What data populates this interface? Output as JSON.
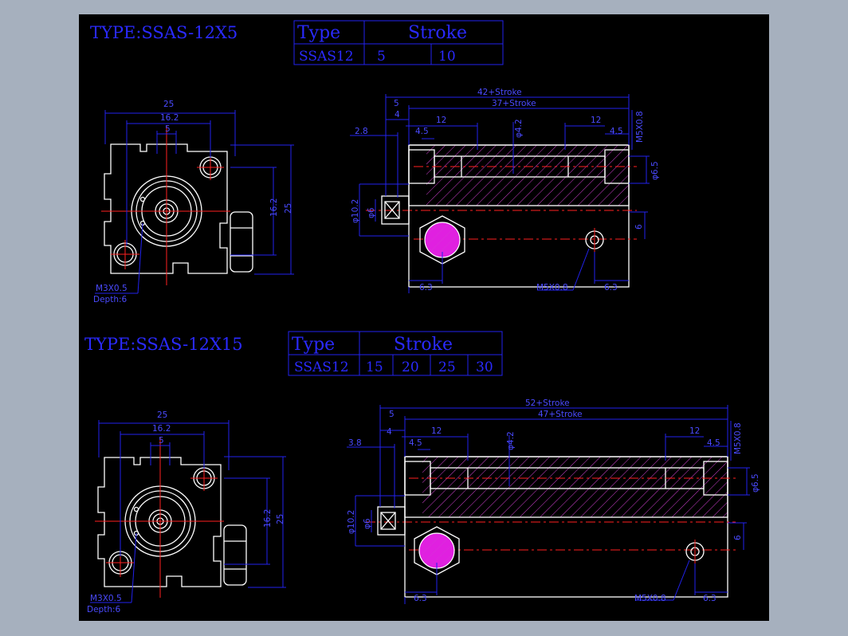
{
  "colors": {
    "background": "#a6b0be",
    "sheet": "#000000",
    "text": "#2a2aff",
    "outline": "#ffffff",
    "center": "#ff2020",
    "hatch": "#d040d0",
    "port": "#e020e0"
  },
  "drawing1": {
    "title": "TYPE:SSAS-12X5",
    "table": {
      "col1": "Type",
      "col2": "Stroke",
      "model": "SSAS12",
      "strokes": [
        "5",
        "10"
      ]
    },
    "front": {
      "d25": "25",
      "d16_2": "16.2",
      "d5": "5",
      "v16_2": "16.2",
      "v25": "25",
      "m3": "M3X0.5",
      "depth": "Depth:6"
    },
    "side": {
      "total": "42+Stroke",
      "d5": "5",
      "d37": "37+Stroke",
      "d4": "4",
      "d12a": "12",
      "d2_8": "2.8",
      "d4_5a": "4.5",
      "phi4_2": "φ4.2",
      "d12b": "12",
      "d4_5b": "4.5",
      "m5top": "M5X0.8",
      "phi6_5": "φ6.5",
      "phi10_2": "φ10.2",
      "phi6": "φ6",
      "v6": "6",
      "d6_3a": "6.3",
      "m5": "M5X0.8",
      "d6_3b": "6.3"
    }
  },
  "drawing2": {
    "title": "TYPE:SSAS-12X15",
    "table": {
      "col1": "Type",
      "col2": "Stroke",
      "model": "SSAS12",
      "strokes": [
        "15",
        "20",
        "25",
        "30"
      ]
    },
    "front": {
      "d25": "25",
      "d16_2": "16.2",
      "d5": "5",
      "v16_2": "16.2",
      "v25": "25",
      "m3": "M3X0.5",
      "depth": "Depth:6"
    },
    "side": {
      "total": "52+Stroke",
      "d5": "5",
      "d47": "47+Stroke",
      "d4": "4",
      "d12a": "12",
      "d3_8": "3.8",
      "d4_5a": "4.5",
      "phi4_2": "φ4.2",
      "d12b": "12",
      "d4_5b": "4.5",
      "m5top": "M5X0.8",
      "phi6_5": "φ6.5",
      "phi10_2": "φ10.2",
      "phi6": "φ6",
      "v6": "6",
      "d6_3a": "6.3",
      "m5": "M5X0.8",
      "d6_3b": "6.3"
    }
  }
}
